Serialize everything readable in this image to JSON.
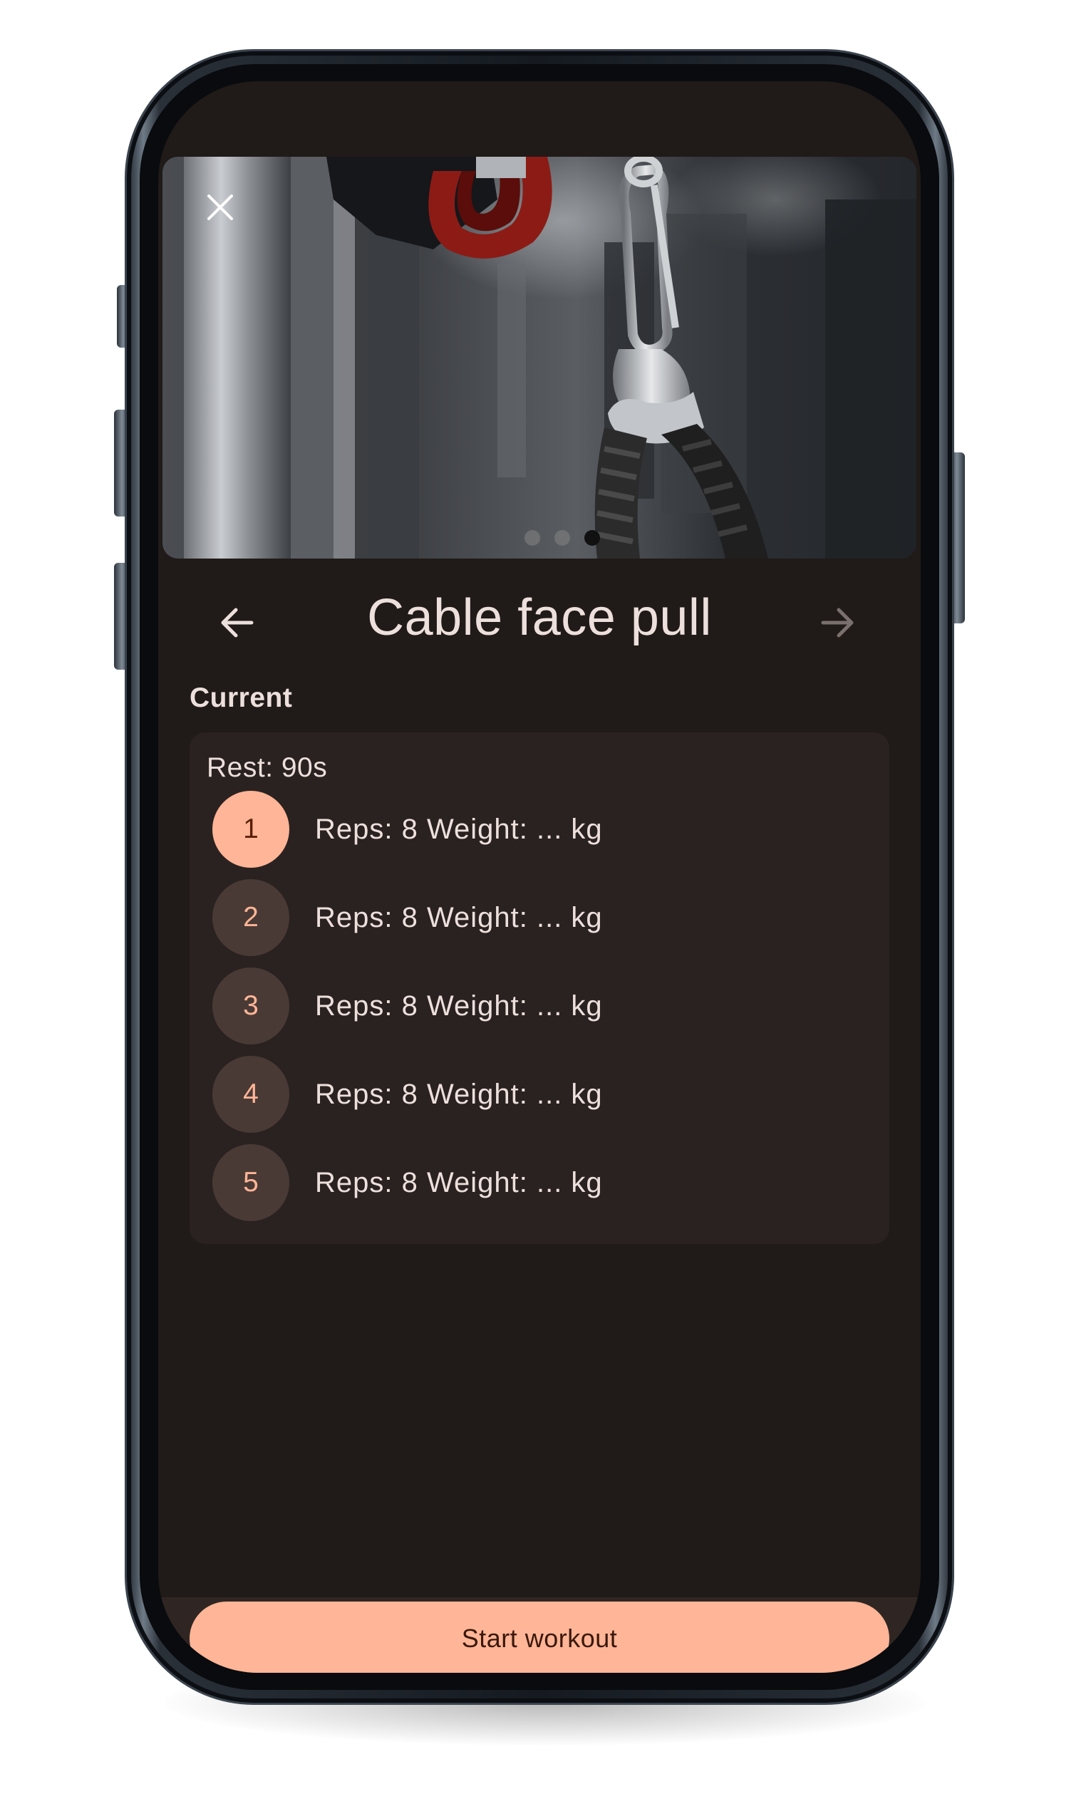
{
  "header": {
    "close_icon": "close-icon",
    "image_alt": "cable-attachment-photo",
    "carousel_total": 3,
    "carousel_active_index": 2
  },
  "exercise": {
    "title": "Cable face pull",
    "prev_icon": "arrow-left-icon",
    "next_icon": "arrow-right-icon"
  },
  "section": {
    "label": "Current"
  },
  "card": {
    "rest": "Rest: 90s",
    "sets": [
      {
        "number": "1",
        "text": "Reps: 8 Weight: ... kg"
      },
      {
        "number": "2",
        "text": "Reps: 8 Weight: ... kg"
      },
      {
        "number": "3",
        "text": "Reps: 8 Weight: ... kg"
      },
      {
        "number": "4",
        "text": "Reps: 8 Weight: ... kg"
      },
      {
        "number": "5",
        "text": "Reps: 8 Weight: ... kg"
      }
    ],
    "active_set": 1
  },
  "footer": {
    "start_label": "Start workout"
  },
  "colors": {
    "background": "#201a18",
    "card": "#2a2220",
    "accent": "#ffb597",
    "set_circle": "#4a3a35",
    "text": "#ede0dc"
  }
}
